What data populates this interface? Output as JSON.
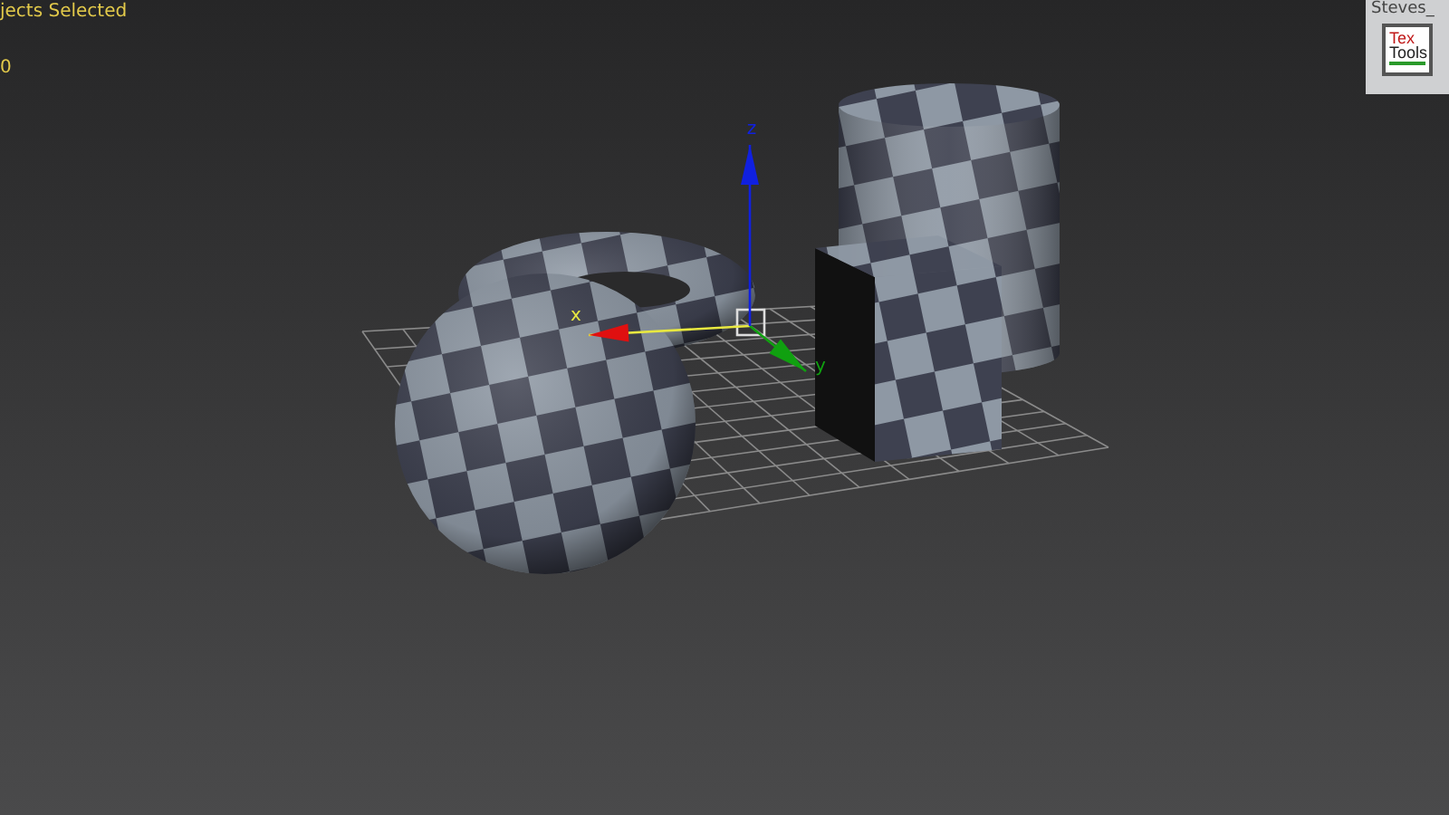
{
  "viewport": {
    "overlay_lines": [
      "jects Selected",
      "0"
    ],
    "gizmo": {
      "axes": [
        {
          "label": "x",
          "color": "#e01010"
        },
        {
          "label": "y",
          "color": "#10a010"
        },
        {
          "label": "z",
          "color": "#1020e0"
        }
      ]
    }
  },
  "toolbar": {
    "title": "Steves_",
    "buttons": [
      {
        "label_top": "Tex",
        "label_bottom": "Tools"
      }
    ]
  }
}
